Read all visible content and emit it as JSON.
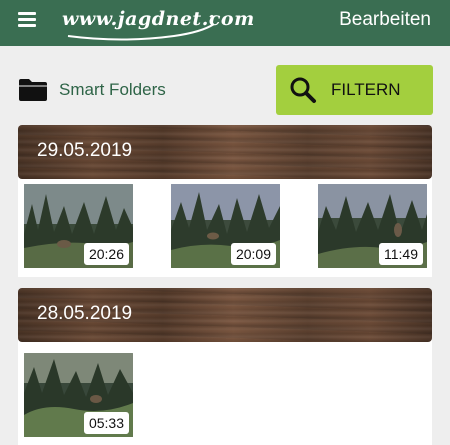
{
  "header": {
    "logo_text": "www.jagdnet.com",
    "edit_label": "Bearbeiten",
    "bar_color": "#3a6e52"
  },
  "toolbar": {
    "smart_folders_label": "Smart Folders",
    "filter_label": "FILTERN",
    "filter_color": "#a3cf3e"
  },
  "sections": [
    {
      "date": "29.05.2019",
      "clips": [
        {
          "duration": "20:26",
          "icon": "video-thumbnail"
        },
        {
          "duration": "20:09",
          "icon": "video-thumbnail"
        },
        {
          "duration": "11:49",
          "icon": "video-thumbnail"
        }
      ]
    },
    {
      "date": "28.05.2019",
      "clips": [
        {
          "duration": "05:33",
          "icon": "video-thumbnail"
        }
      ]
    }
  ]
}
